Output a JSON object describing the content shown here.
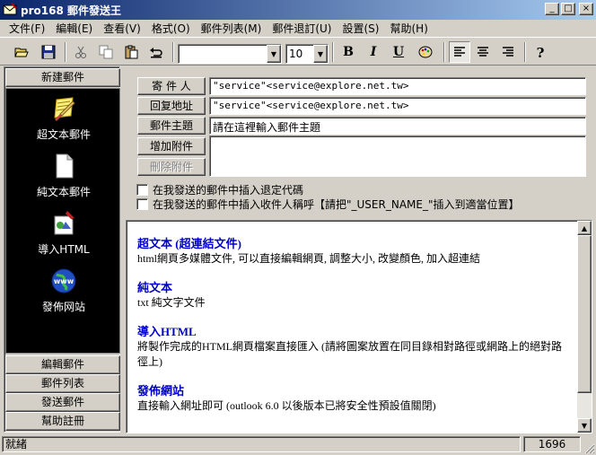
{
  "window": {
    "title": "pro168 郵件發送王",
    "buttons": [
      "_",
      "□",
      "×"
    ]
  },
  "menu": [
    "文件(F)",
    "編輯(E)",
    "查看(V)",
    "格式(O)",
    "郵件列表(M)",
    "郵件退訂(U)",
    "設置(S)",
    "幫助(H)"
  ],
  "toolbar": {
    "font_name": "",
    "font_size": "10",
    "bold_label": "B",
    "italic_label": "I",
    "underline_label": "U"
  },
  "left": {
    "new_mail": "新建郵件",
    "nav": [
      {
        "label": "超文本郵件",
        "icon": "notepad-pencil-icon"
      },
      {
        "label": "純文本郵件",
        "icon": "blank-document-icon"
      },
      {
        "label": "導入HTML",
        "icon": "import-html-icon"
      },
      {
        "label": "發佈网站",
        "icon": "globe-www-icon"
      }
    ],
    "bottom_buttons": [
      "編輯郵件",
      "郵件列表",
      "發送郵件",
      "幫助註冊"
    ]
  },
  "form": {
    "sender_label": "寄 件 人",
    "sender_value": "\"service\"<service@explore.net.tw>",
    "reply_label": "回复地址",
    "reply_value": "\"service\"<service@explore.net.tw>",
    "subject_label": "郵件主題",
    "subject_value": "請在這裡輸入郵件主題",
    "add_attach": "增加附件",
    "remove_attach": "刪除附件",
    "check1": "在我發送的郵件中插入退定代碼",
    "check2": "在我發送的郵件中插入收件人稱呼【請把\"_USER_NAME_\"插入到適當位置】"
  },
  "content": {
    "sections": [
      {
        "title": "超文本 (超連結文件)",
        "desc": "html網頁多媒體文件, 可以直接編輯網頁, 調整大小, 改變顏色, 加入超連結"
      },
      {
        "title": "純文本",
        "desc": "txt 純文字文件"
      },
      {
        "title": "導入HTML",
        "desc": "將製作完成的HTML網頁檔案直接匯入 (請將圖案放置在同目錄相對路徑或網路上的絕對路徑上)"
      },
      {
        "title": "發佈網站",
        "desc": "直接輸入網址即可 (outlook 6.0 以後版本已將安全性預設值關閉)"
      }
    ]
  },
  "status": {
    "text": "就緒",
    "count": "1696"
  }
}
